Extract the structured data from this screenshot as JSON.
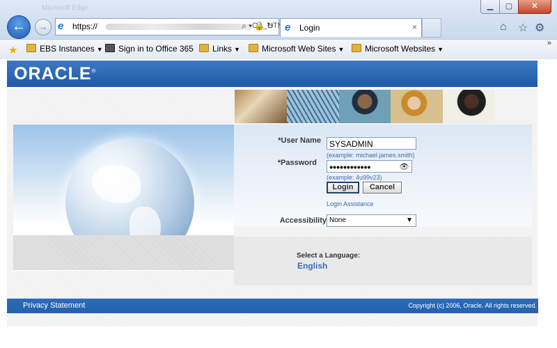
{
  "browser": {
    "title_bar_text": "Microsoft Edge",
    "url_prefix": "https://",
    "url_suffix": "OA_HTM",
    "tab_title": "Login",
    "tab_close": "×",
    "favorites": [
      {
        "label": "EBS Instances",
        "type": "folder"
      },
      {
        "label": "Sign in to Office 365",
        "type": "page"
      },
      {
        "label": "Links",
        "type": "folder"
      },
      {
        "label": "Microsoft Web Sites",
        "type": "folder"
      },
      {
        "label": "Microsoft Websites",
        "type": "folder"
      }
    ],
    "more": "»"
  },
  "page": {
    "logo": "ORACLE",
    "login": {
      "username_label": "*User Name",
      "username_value": "SYSADMIN",
      "username_hint": "(example: michael.james.smith)",
      "password_label": "*Password",
      "password_value": "●●●●●●●●●●●●",
      "password_hint": "(example: 4u99v23)",
      "login_button": "Login",
      "cancel_button": "Cancel",
      "assistance_link": "Login Assistance",
      "accessibility_label": "Accessibility",
      "accessibility_value": "None"
    },
    "language": {
      "label": "Select a Language:",
      "value": "English"
    },
    "footer": {
      "privacy": "Privacy Statement",
      "copyright": "Copyright (c) 2006, Oracle. All rights reserved."
    }
  },
  "colors": {
    "oracle_blue": "#1f5aa8",
    "link_blue": "#3d6aa8",
    "footer_blue": "#2462ad"
  }
}
